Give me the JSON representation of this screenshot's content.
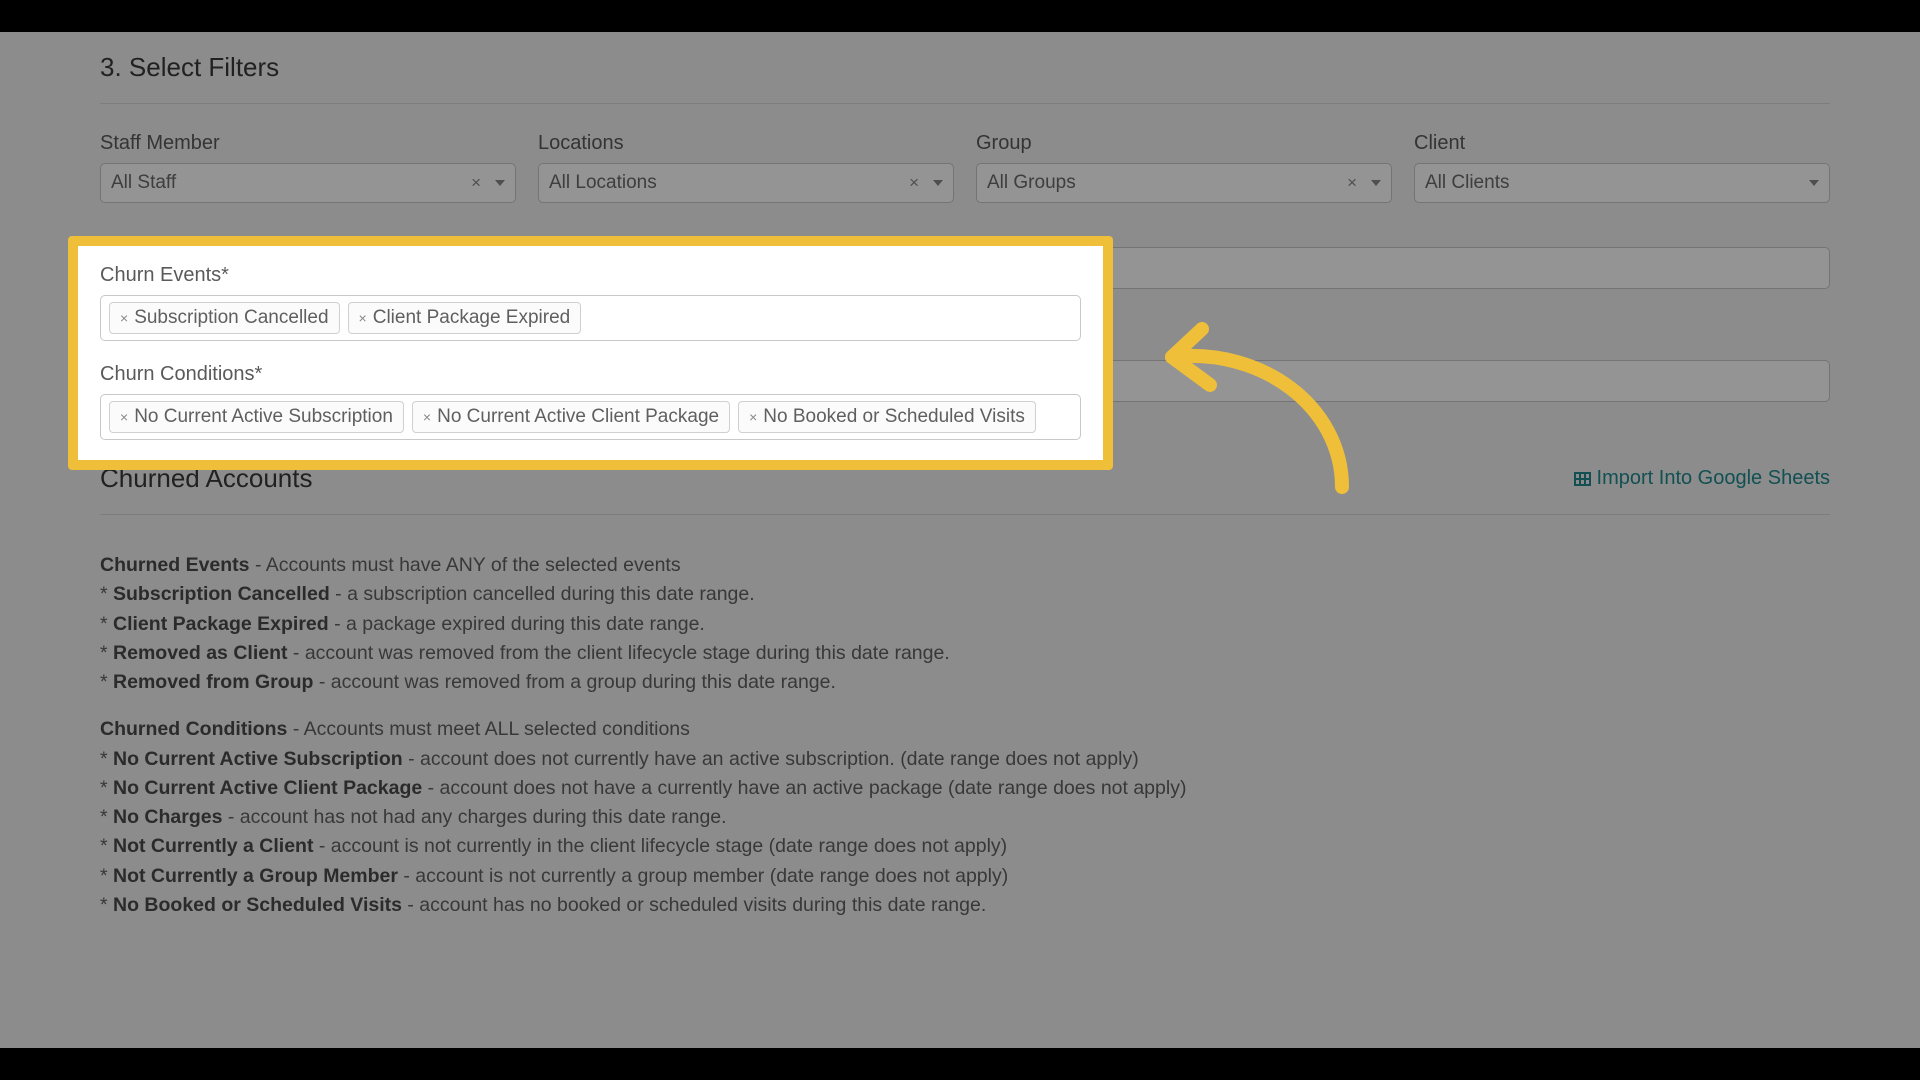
{
  "section_title": "3. Select Filters",
  "filters": {
    "staff": {
      "label": "Staff Member",
      "value": "All Staff",
      "clearable": true
    },
    "loc": {
      "label": "Locations",
      "value": "All Locations",
      "clearable": true
    },
    "group": {
      "label": "Group",
      "value": "All Groups",
      "clearable": true
    },
    "client": {
      "label": "Client",
      "value": "All Clients",
      "clearable": false
    }
  },
  "highlight": {
    "events_label": "Churn Events*",
    "events": [
      "Subscription Cancelled",
      "Client Package Expired"
    ],
    "conditions_label": "Churn Conditions*",
    "conditions": [
      "No Current Active Subscription",
      "No Current Active Client Package",
      "No Booked or Scheduled Visits"
    ]
  },
  "accounts": {
    "title": "Churned Accounts",
    "import_label": "Import Into Google Sheets"
  },
  "desc": {
    "ev_intro_b": "Churned Events",
    "ev_intro_r": " - Accounts must have ANY of the selected events",
    "ev": [
      {
        "b": "Subscription Cancelled",
        "r": " - a subscription cancelled during this date range."
      },
      {
        "b": "Client Package Expired",
        "r": " - a package expired during this date range."
      },
      {
        "b": "Removed as Client",
        "r": " - account was removed from the client lifecycle stage during this date range."
      },
      {
        "b": "Removed from Group",
        "r": " - account was removed from a group during this date range."
      }
    ],
    "cd_intro_b": "Churned Conditions",
    "cd_intro_r": " - Accounts must meet ALL selected conditions",
    "cd": [
      {
        "b": "No Current Active Subscription",
        "r": " - account does not currently have an active subscription. (date range does not apply)"
      },
      {
        "b": "No Current Active Client Package",
        "r": " - account does not have a currently have an active package (date range does not apply)"
      },
      {
        "b": "No Charges",
        "r": " - account has not had any charges during this date range."
      },
      {
        "b": "Not Currently a Client",
        "r": " - account is not currently in the client lifecycle stage (date range does not apply)"
      },
      {
        "b": "Not Currently a Group Member",
        "r": " - account is not currently a group member (date range does not apply)"
      },
      {
        "b": "No Booked or Scheduled Visits",
        "r": " - account has no booked or scheduled visits during this date range."
      }
    ]
  }
}
